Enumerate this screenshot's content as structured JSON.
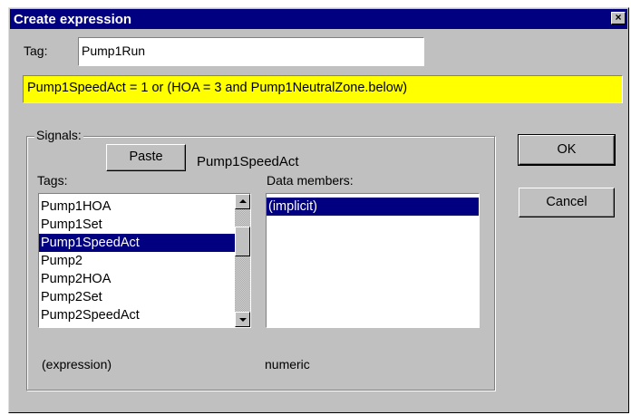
{
  "window": {
    "title": "Create expression",
    "close_glyph": "×"
  },
  "tag": {
    "label": "Tag:",
    "value": "Pump1Run"
  },
  "expression": {
    "text": "Pump1SpeedAct = 1 or (HOA = 3 and Pump1NeutralZone.below)",
    "highlight_color": "#ffff00"
  },
  "signals": {
    "group_label": "Signals:",
    "paste_label": "Paste",
    "selected_signal": "Pump1SpeedAct",
    "tags_label": "Tags:",
    "tags": [
      {
        "label": "Pump1HOA"
      },
      {
        "label": "Pump1Set"
      },
      {
        "label": "Pump1SpeedAct"
      },
      {
        "label": "Pump2"
      },
      {
        "label": "Pump2HOA"
      },
      {
        "label": "Pump2Set"
      },
      {
        "label": "Pump2SpeedAct"
      }
    ],
    "selected_tag": "Pump1SpeedAct",
    "members_label": "Data members:",
    "members": [
      {
        "label": "(implicit)"
      }
    ],
    "selected_member": "(implicit)",
    "footer_left": "(expression)",
    "footer_right": "numeric"
  },
  "buttons": {
    "ok_label": "OK",
    "cancel_label": "Cancel"
  },
  "colors": {
    "title_bar": "#000080",
    "selection": "#000080",
    "dialog_face": "#c0c0c0"
  }
}
